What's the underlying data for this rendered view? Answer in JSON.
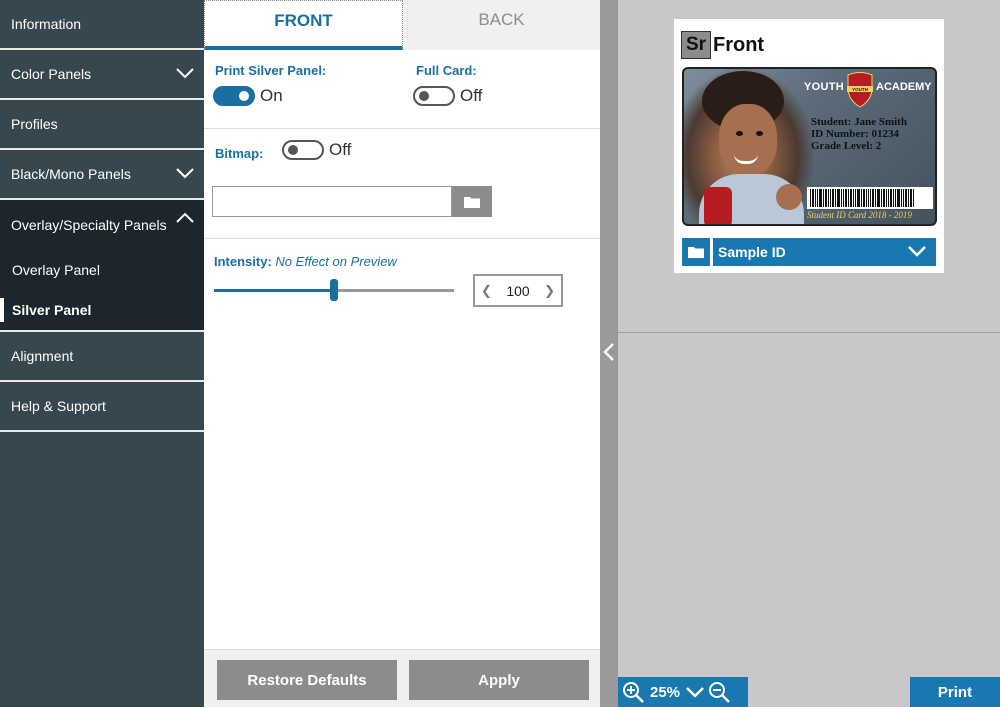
{
  "sidebar": {
    "items": [
      {
        "label": "Information"
      },
      {
        "label": "Color Panels"
      },
      {
        "label": "Profiles"
      },
      {
        "label": "Black/Mono Panels"
      },
      {
        "label": "Overlay/Specialty Panels"
      },
      {
        "label": "Alignment"
      },
      {
        "label": "Help & Support"
      }
    ],
    "subitems": [
      {
        "label": "Overlay Panel"
      },
      {
        "label": "Silver Panel"
      }
    ]
  },
  "tabs": {
    "front": "FRONT",
    "back": "BACK"
  },
  "settings": {
    "print_silver_label": "Print Silver Panel:",
    "print_silver_state": "On",
    "full_card_label": "Full Card:",
    "full_card_state": "Off",
    "bitmap_label": "Bitmap:",
    "bitmap_state": "Off",
    "bitmap_path": "",
    "intensity_label": "Intensity:",
    "intensity_note": "No Effect on Preview",
    "intensity_value": "100",
    "intensity_fraction": 0.5
  },
  "footer": {
    "restore": "Restore Defaults",
    "apply": "Apply"
  },
  "preview": {
    "badge": "Sr",
    "title": "Front",
    "card": {
      "youth": "YOUTH",
      "academy": "ACADEMY",
      "crest": "YOUTH",
      "student": "Student: Jane Smith",
      "id_number": "ID Number: 01234",
      "grade": "Grade Level: 2",
      "footer_text": "Student ID Card 2018 - 2019"
    },
    "select_value": "Sample ID"
  },
  "bottom": {
    "zoom": "25%",
    "print": "Print"
  },
  "colors": {
    "accent": "#1a78b0",
    "sidebar": "#37474f",
    "button_gray": "#8c8c8c"
  }
}
